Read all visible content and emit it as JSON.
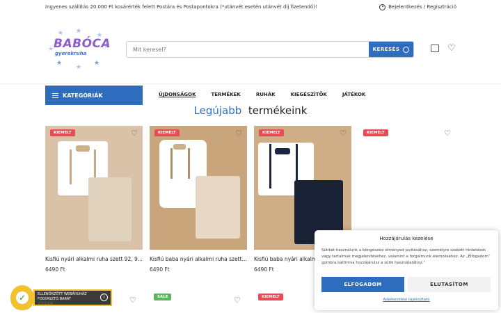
{
  "topbar": {
    "shipping_notice": "Ingyenes szállítás 20.000 Ft kosárérték felett Postára és Postapontokra (*utánvét esetén utánvét díj fizetendő)!",
    "login_link": "Bejelentkezés / Regisztráció"
  },
  "logo": {
    "line1": "BABÓCA",
    "line2": "gyerekruha"
  },
  "search": {
    "placeholder": "Mit keresel?",
    "button_label": "KERESÉS"
  },
  "nav": {
    "categories_label": "KATEGÓRIÁK",
    "items": [
      "ÚJDONSÁGOK",
      "TERMÉKEK",
      "RUHÁK",
      "KIEGÉSZÍTŐK",
      "JÁTÉKOK"
    ]
  },
  "section": {
    "title_part1": "Legújabb",
    "title_part2": "termékeink"
  },
  "products": [
    {
      "badge": "KIEMELT",
      "name": "Kisfiú nyári alkalmi ruha szett 92, 9...",
      "price": "6490 Ft"
    },
    {
      "badge": "KIEMELT",
      "name": "Kisfiú baba nyári alkalmi ruha szett ...",
      "price": "6490 Ft"
    },
    {
      "badge": "KIEMELT",
      "name": "Kisfiú baba nyári alkalmi ruha szett ...",
      "price": "6490 Ft"
    },
    {
      "badge": "KIEMELT",
      "name": "",
      "price": ""
    }
  ],
  "row2_badges": [
    "SALE",
    "KIEMELT"
  ],
  "cookie": {
    "title": "Hozzájárulás kezelése",
    "text": "Sütiket használunk a böngészési élményed javításához, személyre szabott hirdetések vagy tartalmak megjelenítéséhez, valamint a forgalmunk elemzéséhez. Az „Elfogadom” gombra kattintva hozzájárulsz a sütik használatához.”",
    "accept_label": "ELFOGADOM",
    "deny_label": "ELUTASÍTOM",
    "policy_link": "Adatkezelési tájékoztató"
  },
  "trust_badge": {
    "line1": "ELLENŐRZÖTT WEBÁRUHÁZ",
    "line2": "FOGYASZTÓ BARÁT",
    "stars": "☆☆☆☆☆"
  },
  "colors": {
    "primary": "#2e6dbd",
    "badge_red": "#e94b55",
    "badge_green": "#5ab55e"
  }
}
